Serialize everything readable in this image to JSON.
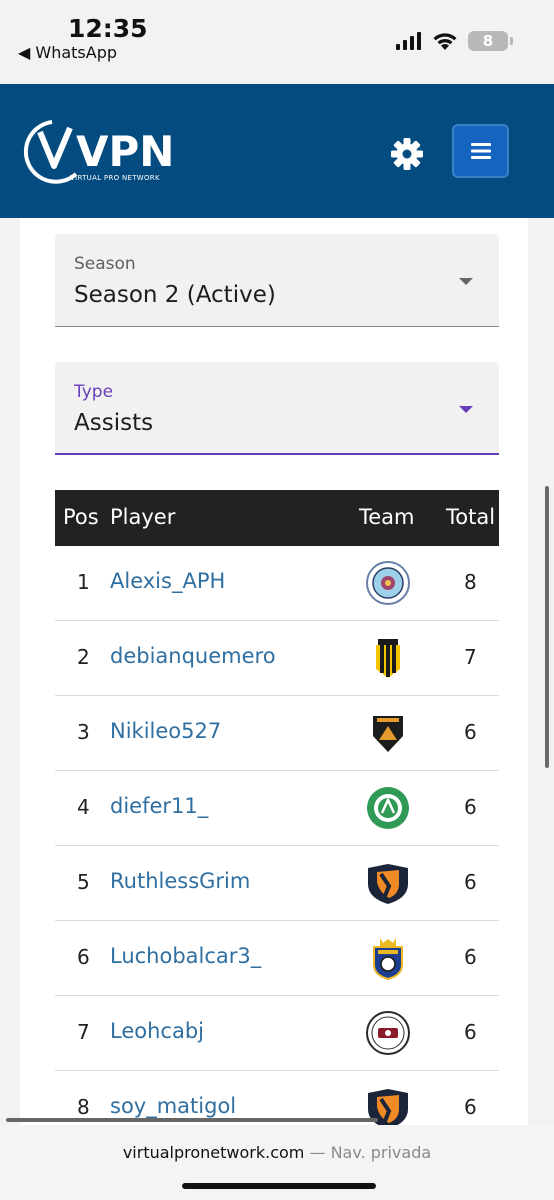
{
  "status_bar": {
    "time": "12:35",
    "back_app": "◀ WhatsApp",
    "battery": "8"
  },
  "header": {
    "logo_text": "VPN",
    "logo_subtitle": "VIRTUAL PRO NETWORK",
    "brand_color": "#044b7f"
  },
  "filters": {
    "season": {
      "label": "Season",
      "value": "Season 2 (Active)"
    },
    "type": {
      "label": "Type",
      "value": "Assists",
      "accent": "#6a3db8"
    }
  },
  "table": {
    "headers": {
      "pos": "Pos",
      "player": "Player",
      "team": "Team",
      "total": "Total"
    },
    "rows": [
      {
        "pos": "1",
        "player": "Alexis_APH",
        "team_icon": "club-crest-circle-blue",
        "total": "8"
      },
      {
        "pos": "2",
        "player": "debianquemero",
        "team_icon": "club-crest-yellow-black-stripes",
        "total": "7"
      },
      {
        "pos": "3",
        "player": "Nikileo527",
        "team_icon": "club-crest-black-shield-orange",
        "total": "6"
      },
      {
        "pos": "4",
        "player": "diefer11_",
        "team_icon": "club-crest-green-circle",
        "total": "6"
      },
      {
        "pos": "5",
        "player": "RuthlessGrim",
        "team_icon": "club-crest-orange-navy-shield",
        "total": "6"
      },
      {
        "pos": "6",
        "player": "Luchobalcar3_",
        "team_icon": "club-crest-crowned-shield-blue",
        "total": "6"
      },
      {
        "pos": "7",
        "player": "Leohcabj",
        "team_icon": "club-crest-white-circle",
        "total": "6"
      },
      {
        "pos": "8",
        "player": "soy_matigol",
        "team_icon": "club-crest-orange-navy-shield",
        "total": "6"
      }
    ]
  },
  "browser": {
    "domain": "virtualpronetwork.com",
    "separator": " — ",
    "mode": "Nav. privada"
  }
}
